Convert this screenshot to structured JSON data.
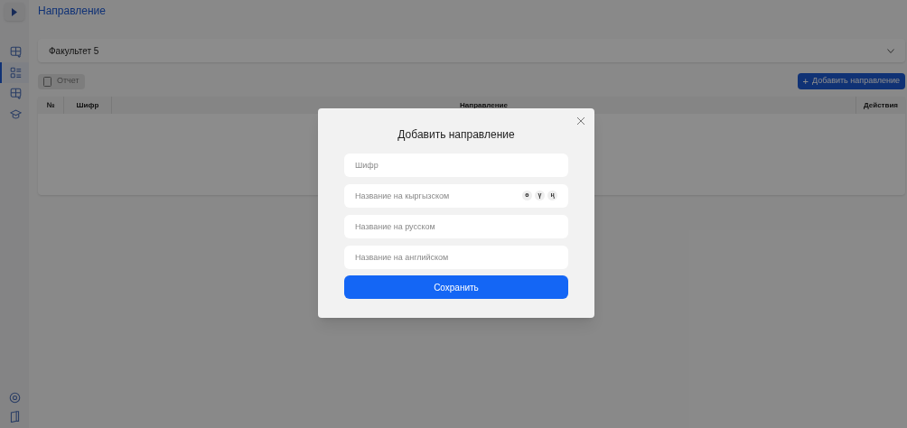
{
  "page_title": "Направление",
  "sidebar": {
    "items": [
      {
        "kind": "grid",
        "selected": false
      },
      {
        "kind": "list",
        "selected": true
      },
      {
        "kind": "grid",
        "selected": false
      },
      {
        "kind": "cap",
        "selected": false
      }
    ],
    "bottom": [
      {
        "kind": "settings"
      },
      {
        "kind": "book"
      }
    ]
  },
  "faculty_select": {
    "value": "Факультет 5"
  },
  "report_button": {
    "label": "Отчет",
    "disabled": true
  },
  "add_button": {
    "label": "Добавить направление",
    "icon": "+"
  },
  "table": {
    "columns": [
      "№",
      "Шифр",
      "Направление",
      "Действия"
    ]
  },
  "dialog": {
    "title": "Добавить направление",
    "fields": [
      {
        "placeholder": "Шифр"
      },
      {
        "placeholder": "Название на кыргызском",
        "letters": [
          "ө",
          "ү",
          "ң"
        ]
      },
      {
        "placeholder": "Название на русском"
      },
      {
        "placeholder": "Название на английском"
      }
    ],
    "submit": "Сохранить"
  }
}
